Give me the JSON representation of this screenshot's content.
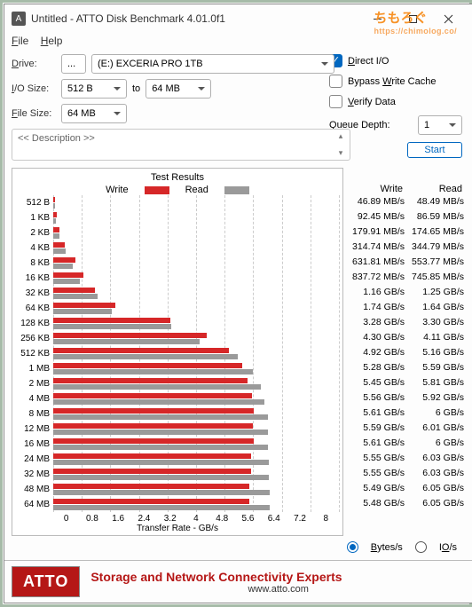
{
  "titlebar": {
    "icon_letter": "A",
    "title": "Untitled - ATTO Disk Benchmark 4.01.0f1"
  },
  "watermark": {
    "main": "ちもろぐ",
    "sub": "https://chimolog.co/"
  },
  "menubar": {
    "file": "File",
    "help": "Help"
  },
  "form": {
    "drive_label": "Drive:",
    "drive_btn": "...",
    "drive_value": "(E:) EXCERIA PRO 1TB",
    "iosize_label": "I/O Size:",
    "iosize_from": "512 B",
    "iosize_to_label": "to",
    "iosize_to": "64 MB",
    "filesize_label": "File Size:",
    "filesize_value": "64 MB"
  },
  "options": {
    "direct_io": "Direct I/O",
    "bypass": "Bypass Write Cache",
    "verify": "Verify Data",
    "queue_label": "Queue Depth:",
    "queue_value": "1",
    "start": "Start"
  },
  "description": {
    "label": "<< Description >>"
  },
  "chart": {
    "title": "Test Results",
    "legend_write": "Write",
    "legend_read": "Read",
    "xaxis_label": "Transfer Rate - GB/s",
    "results_head_write": "Write",
    "results_head_read": "Read",
    "radio_bytes": "Bytes/s",
    "radio_ios": "IO/s"
  },
  "chart_data": {
    "type": "bar",
    "xlabel": "Transfer Rate - GB/s",
    "xlim": [
      0,
      8
    ],
    "xticks": [
      0,
      0.8,
      1.6,
      2.4,
      3.2,
      4,
      4.8,
      5.6,
      6.4,
      7.2,
      8
    ],
    "categories": [
      "512 B",
      "1 KB",
      "2 KB",
      "4 KB",
      "8 KB",
      "16 KB",
      "32 KB",
      "64 KB",
      "128 KB",
      "256 KB",
      "512 KB",
      "1 MB",
      "2 MB",
      "4 MB",
      "8 MB",
      "12 MB",
      "16 MB",
      "24 MB",
      "32 MB",
      "48 MB",
      "64 MB"
    ],
    "series": [
      {
        "name": "Write",
        "color": "#d62728",
        "values_gb": [
          0.04689,
          0.09245,
          0.17991,
          0.31474,
          0.63181,
          0.83772,
          1.16,
          1.74,
          3.28,
          4.3,
          4.92,
          5.28,
          5.45,
          5.56,
          5.61,
          5.59,
          5.61,
          5.55,
          5.55,
          5.49,
          5.48
        ],
        "display": [
          "46.89 MB/s",
          "92.45 MB/s",
          "179.91 MB/s",
          "314.74 MB/s",
          "631.81 MB/s",
          "837.72 MB/s",
          "1.16 GB/s",
          "1.74 GB/s",
          "3.28 GB/s",
          "4.30 GB/s",
          "4.92 GB/s",
          "5.28 GB/s",
          "5.45 GB/s",
          "5.56 GB/s",
          "5.61 GB/s",
          "5.59 GB/s",
          "5.61 GB/s",
          "5.55 GB/s",
          "5.55 GB/s",
          "5.49 GB/s",
          "5.48 GB/s"
        ]
      },
      {
        "name": "Read",
        "color": "#9a9a9a",
        "values_gb": [
          0.04849,
          0.08659,
          0.17465,
          0.34479,
          0.55377,
          0.74585,
          1.25,
          1.64,
          3.3,
          4.11,
          5.16,
          5.59,
          5.81,
          5.92,
          6.0,
          6.01,
          6.0,
          6.03,
          6.03,
          6.05,
          6.05
        ],
        "display": [
          "48.49 MB/s",
          "86.59 MB/s",
          "174.65 MB/s",
          "344.79 MB/s",
          "553.77 MB/s",
          "745.85 MB/s",
          "1.25 GB/s",
          "1.64 GB/s",
          "3.30 GB/s",
          "4.11 GB/s",
          "5.16 GB/s",
          "5.59 GB/s",
          "5.81 GB/s",
          "5.92 GB/s",
          "6 GB/s",
          "6.01 GB/s",
          "6 GB/s",
          "6.03 GB/s",
          "6.03 GB/s",
          "6.05 GB/s",
          "6.05 GB/s"
        ]
      }
    ]
  },
  "footer": {
    "logo": "ATTO",
    "headline": "Storage and Network Connectivity Experts",
    "url": "www.atto.com"
  }
}
